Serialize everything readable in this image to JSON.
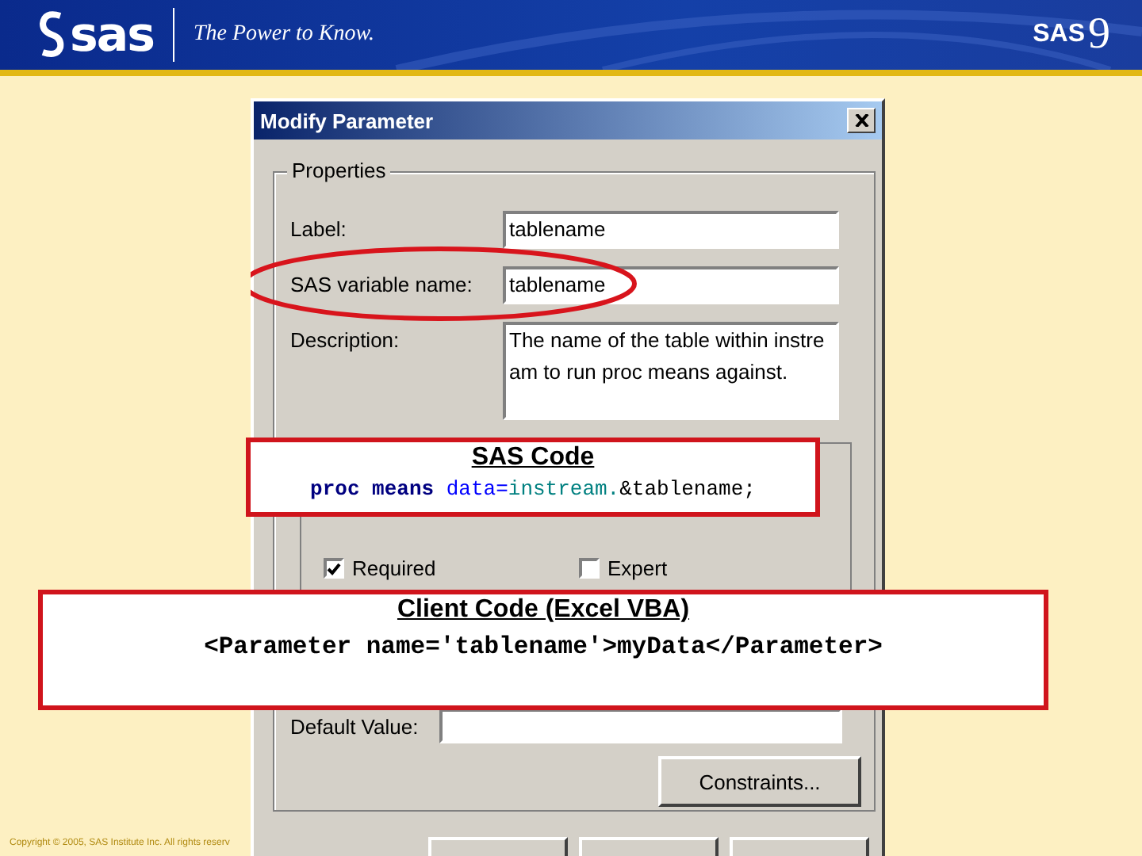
{
  "header": {
    "logo": "sas",
    "tagline": "The Power to Know.",
    "product": "SAS",
    "version": "9"
  },
  "dialog": {
    "title": "Modify Parameter",
    "group_title": "Properties",
    "fields": [
      {
        "label": "Label:",
        "value": "tablename",
        "kind": "line"
      },
      {
        "label": "SAS variable name:",
        "value": "tablename",
        "kind": "line"
      },
      {
        "label": "Description:",
        "value": "The name of the table within instream to run proc means against.",
        "kind": "multiline"
      }
    ],
    "options": [
      {
        "label": "Required",
        "checked": true
      },
      {
        "label": "Expert",
        "checked": false
      }
    ],
    "default_label": "Default Value:",
    "constraints_button": "Constraints..."
  },
  "callouts": [
    {
      "title": "SAS Code",
      "segments": [
        {
          "text": "proc means ",
          "kind": "keyword"
        },
        {
          "text": "data=",
          "kind": "option"
        },
        {
          "text": "instream.",
          "kind": "library"
        },
        {
          "text": "&tablename;",
          "kind": "plain"
        }
      ]
    },
    {
      "title": "Client Code (Excel VBA)",
      "segments": [
        {
          "text": "<Parameter name='tablename'>myData</Parameter>",
          "kind": "plain"
        }
      ]
    }
  ],
  "copyright": "Copyright © 2005, SAS Institute Inc. All rights reserv"
}
